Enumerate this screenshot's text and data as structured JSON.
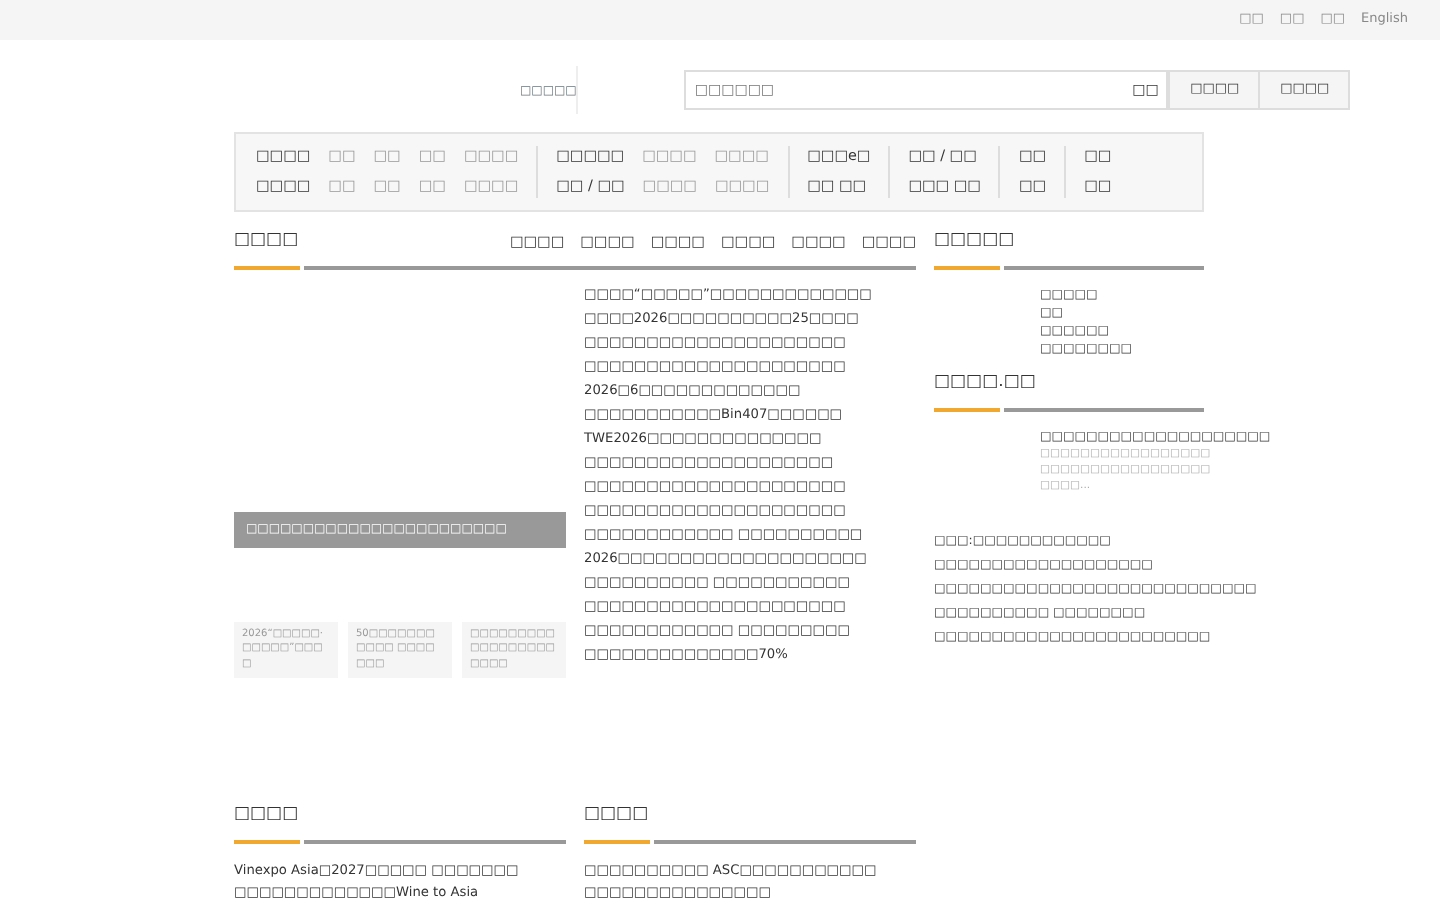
{
  "top_links": [
    "□□",
    "□□",
    "□□",
    "English"
  ],
  "logo_text": "□□□□□",
  "search": {
    "placeholder": "□□□□□□",
    "button": "□□"
  },
  "header_buttons": [
    "□□□□",
    "□□□□"
  ],
  "nav_groups": [
    {
      "rows": [
        {
          "head": "□□□□",
          "links": [
            "□□",
            "□□",
            "□□",
            "□□□□"
          ]
        },
        {
          "head": "□□□□",
          "links": [
            "□□",
            "□□",
            "□□",
            "□□□□"
          ]
        }
      ]
    },
    {
      "rows": [
        {
          "head": "□□□□□",
          "links": [
            "□□□□",
            "□□□□"
          ]
        },
        {
          "head": "□□ / □□",
          "links": [
            "□□□□",
            "□□□□"
          ]
        }
      ]
    },
    {
      "rows": [
        {
          "head": "□□□e□",
          "links": []
        },
        {
          "head": "□□ □□",
          "links": []
        }
      ]
    },
    {
      "rows": [
        {
          "head": "□□ / □□",
          "links": []
        },
        {
          "head": "□□□ □□",
          "links": []
        }
      ]
    },
    {
      "rows": [
        {
          "head": "□□",
          "links": []
        },
        {
          "head": "□□",
          "links": []
        }
      ]
    },
    {
      "rows": [
        {
          "head": "□□",
          "links": []
        },
        {
          "head": "□□",
          "links": []
        }
      ]
    }
  ],
  "news": {
    "title": "□□□□",
    "tabs": [
      "□□□□",
      "□□□□",
      "□□□□",
      "□□□□",
      "□□□□",
      "□□□□"
    ],
    "caption": "□□□□□□□□□□□□□□□□□□□□□□□",
    "thumbs": [
      "2026“□□□□□·□□□□□”□□□□",
      "50□□□□□□□□□□□ □□□□□□□",
      "□□□□□□□□□□□□□□□□□□□□□□"
    ],
    "headlines": [
      "□□□□“□□□□□”□□□□□□□□□□□□□",
      "□□□□2026□□□□□□□□□□25□□□□",
      "□□□□□□□□□□□□□□□□□□□□□",
      "□□□□□□□□□□□□□□□□□□□□□",
      "2026□6□□□□□□□□□□□□□",
      "□□□□□□□□□□□Bin407□□□□□□",
      "TWE2026□□□□□□□□□□□□□□",
      "□□□□□□□□□□□□□□□□□□□□",
      "□□□□□□□□□□□□□□□□□□□□□",
      "□□□□□□□□□□□□□□□□□□□□□",
      "□□□□□□□□□□□□ □□□□□□□□□□",
      "2026□□□□□□□□□□□□□□□□□□□□",
      "□□□□□□□□□□ □□□□□□□□□□□",
      "□□□□□□□□□□□□□□□□□□□□□",
      "□□□□□□□□□□□□ □□□□□□□□□",
      "□□□□□□□□□□□□□□70%"
    ]
  },
  "side": [
    {
      "title": "□□□□□",
      "links": [
        "□□□□□",
        "□□",
        "□□□□□□",
        "□□□□□□□□"
      ]
    },
    {
      "title": "□□□□.□□",
      "feature_title": "□□□□□□□□□□□□□□□□□□□□",
      "feature_desc": "□□□□□□□□□□□□□□□□□□□□□□□□□□□□□□□□□□□□□□...",
      "links": [
        "□□□:□□□□□□□□□□□□",
        "□□□□□□□□□□□□□□□□□□□",
        "□□□□□□□□□□□□□□□□□□□□□□□□□□□□",
        "□□□□□□□□□□ □□□□□□□□",
        "□□□□□□□□□□□□□□□□□□□□□□□□"
      ]
    }
  ],
  "bottom": [
    {
      "title": "□□□□",
      "lines": [
        "Vinexpo Asia□2027□□□□□ □□□□□□□",
        "□□□□□□□□□□□□□Wine to Asia"
      ]
    },
    {
      "title": "□□□□",
      "lines": [
        "□□□□□□□□□□ ASC□□□□□□□□□□□",
        "□□□□□□□□□□□□□□□"
      ]
    }
  ]
}
